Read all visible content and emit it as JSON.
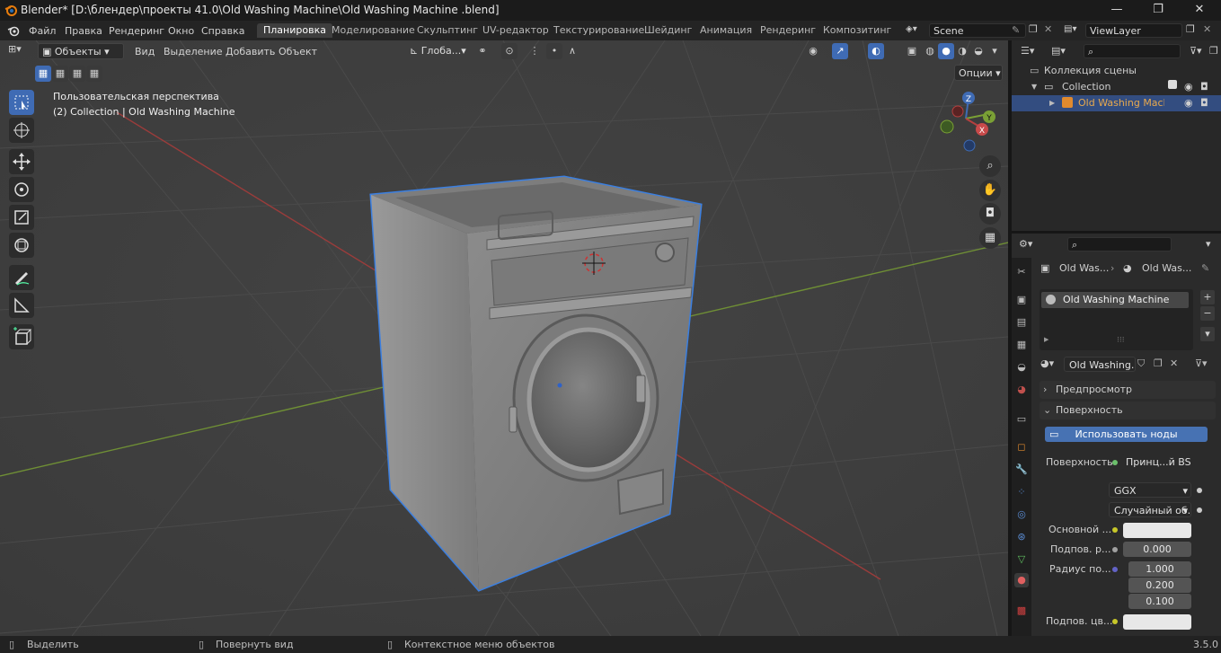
{
  "window": {
    "title": "Blender* [D:\\блендер\\проекты 41.0\\Old Washing Machine\\Old Washing Machine .blend]"
  },
  "menu": [
    "Файл",
    "Правка",
    "Рендеринг",
    "Окно",
    "Справка"
  ],
  "workspaces": [
    "Планировка",
    "Моделирование",
    "Скульптинг",
    "UV-редактор",
    "Текстурирование",
    "Шейдинг",
    "Анимация",
    "Рендеринг",
    "Композитинг"
  ],
  "scene": {
    "name": "Scene"
  },
  "view_layer": {
    "name": "ViewLayer"
  },
  "viewport_header": {
    "mode": "Объекты",
    "menus": [
      "Вид",
      "Выделение",
      "Добавить",
      "Объект"
    ],
    "transform_orientation": "Глоба...",
    "options": "Опции"
  },
  "viewport": {
    "perspective_label": "Пользовательская перспектива",
    "collection_label": "(2) Collection | Old Washing Machine"
  },
  "gizmo": {
    "x": "X",
    "y": "Y",
    "z": "Z"
  },
  "outliner": {
    "scene_collection": "Коллекция сцены",
    "collection": "Collection",
    "object": "Old Washing Machine"
  },
  "properties": {
    "breadcrumb_obj": "Old Was...",
    "breadcrumb_mat": "Old Was...",
    "material_slot": "Old Washing Machine",
    "material_name": "Old Washing...",
    "panel_preview": "Предпросмотр",
    "panel_surface": "Поверхность",
    "use_nodes": "Использовать ноды",
    "surface_label": "Поверхность",
    "surface_value": "Принц...й BSDF",
    "distribution": "GGX",
    "subsurface_method": "Случайный об...",
    "base_color_label": "Основной ...",
    "subsurface_label": "Подпов. р...",
    "subsurface_value": "0.000",
    "radius_label": "Радиус по...",
    "radius_values": [
      "1.000",
      "0.200",
      "0.100"
    ],
    "subsurface_color_label": "Подпов. цв..."
  },
  "statusbar": {
    "select": "Выделить",
    "rotate": "Повернуть вид",
    "context": "Контекстное меню объектов",
    "version": "3.5.0"
  },
  "colors": {
    "accent": "#4772b3",
    "selection_outline": "#3b7fe0",
    "active_text": "#e8a94e",
    "x_axis": "#b5403f",
    "y_axis": "#7aa035"
  }
}
